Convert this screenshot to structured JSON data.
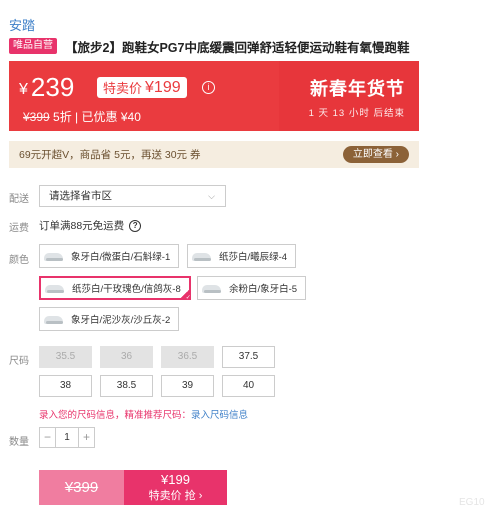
{
  "brand": "安踏",
  "product": {
    "tag": "唯品自营",
    "title": "【旅步2】跑鞋女PG7中底缓震回弹舒适轻便运动鞋有氧慢跑鞋"
  },
  "price": {
    "currency": "¥",
    "current": "239",
    "sale_tag_label": "特卖价",
    "sale_tag_value": "¥199",
    "original": "¥399",
    "discount_text": "5折 | 已优惠 ¥40",
    "festival": "新春年货节",
    "countdown": "1 天 13 小时 后结束"
  },
  "coupon": {
    "text": "69元开超V，商品省 5元，再送 30元 券",
    "button": "立即查看 ›"
  },
  "delivery": {
    "label": "配送",
    "placeholder": "请选择省市区",
    "chevron_icon": "chevron-down-icon"
  },
  "freight": {
    "label": "运费",
    "text": "订单满88元免运费",
    "icon": "question-icon"
  },
  "colors": {
    "label": "颜色",
    "options": [
      {
        "name": "象牙白/微蛋白/石斛绿-1",
        "selected": false
      },
      {
        "name": "纸莎白/曦辰绿-4",
        "selected": false
      },
      {
        "name": "纸莎白/干玫瑰色/信鸽灰-8",
        "selected": true
      },
      {
        "name": "余粉白/象牙白-5",
        "selected": false
      },
      {
        "name": "象牙白/泥沙灰/沙丘灰-2",
        "selected": false
      }
    ]
  },
  "sizes": {
    "label": "尺码",
    "options": [
      {
        "value": "35.5",
        "disabled": true
      },
      {
        "value": "36",
        "disabled": true
      },
      {
        "value": "36.5",
        "disabled": true
      },
      {
        "value": "37.5",
        "disabled": false
      },
      {
        "value": "38",
        "disabled": false
      },
      {
        "value": "38.5",
        "disabled": false
      },
      {
        "value": "39",
        "disabled": false
      },
      {
        "value": "40",
        "disabled": false
      }
    ],
    "tip": "录入您的尺码信息，精准推荐尺码：",
    "tip_link": "录入尺码信息"
  },
  "quantity": {
    "label": "数量",
    "minus": "−",
    "value": "1",
    "plus": "+"
  },
  "buy": {
    "original": "¥399",
    "sale_price": "¥199",
    "sale_label": "特卖价 抢 ›"
  },
  "watermark": "EG10",
  "colors_palette": {
    "accent_pink": "#e8336b",
    "banner_red": "#ea3b3f",
    "link_blue": "#3f80c8",
    "coupon_brown": "#8c6238"
  }
}
